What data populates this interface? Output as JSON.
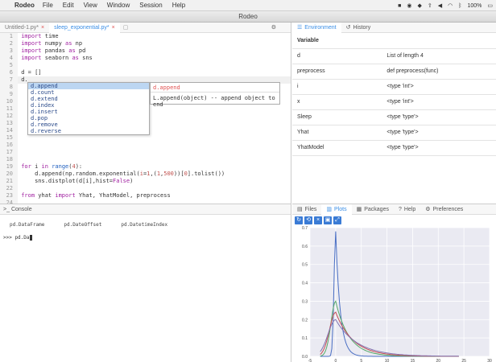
{
  "menubar": {
    "app_name": "Rodeo",
    "items": [
      "File",
      "Edit",
      "View",
      "Window",
      "Session",
      "Help"
    ],
    "battery": "100%"
  },
  "window": {
    "title": "Rodeo"
  },
  "editor": {
    "tabs": [
      {
        "label": "Untitled-1.py*"
      },
      {
        "label": "sleep_exponential.py*"
      }
    ],
    "autocomplete": {
      "items": [
        "d.append",
        "d.count",
        "d.extend",
        "d.index",
        "d.insert",
        "d.pop",
        "d.remove",
        "d.reverse"
      ],
      "doc_title": "d.append",
      "doc_text": "L.append(object) -- append object to end"
    }
  },
  "environment": {
    "tabs": [
      "Environment",
      "History"
    ],
    "header": "Variable",
    "rows": [
      {
        "name": "d",
        "value": "List of length 4"
      },
      {
        "name": "preprocess",
        "value": "def preprocess(func)"
      },
      {
        "name": "i",
        "value": "<type 'int'>"
      },
      {
        "name": "x",
        "value": "<type 'int'>"
      },
      {
        "name": "Sleep",
        "value": "<type 'type'>"
      },
      {
        "name": "Yhat",
        "value": "<type 'type'>"
      },
      {
        "name": "YhatModel",
        "value": "<type 'type'>"
      }
    ]
  },
  "console": {
    "title": "Console",
    "suggestions": [
      "pd.DataFrame",
      "pd.DateOffset",
      "pd.DatetimeIndex"
    ],
    "prompt": ">>> pd.Da"
  },
  "plots": {
    "tabs": [
      "Files",
      "Plots",
      "Packages",
      "Help",
      "Preferences"
    ],
    "y_ticks": [
      "0.7",
      "0.6",
      "0.5",
      "0.4",
      "0.3",
      "0.2",
      "0.1",
      "0.0"
    ],
    "x_ticks": [
      "-5",
      "0",
      "5",
      "10",
      "15",
      "20",
      "25",
      "30"
    ],
    "colors": {
      "blue": "#4a6fc4",
      "green": "#55a868",
      "red": "#c44e52",
      "purple": "#8172b2"
    }
  }
}
